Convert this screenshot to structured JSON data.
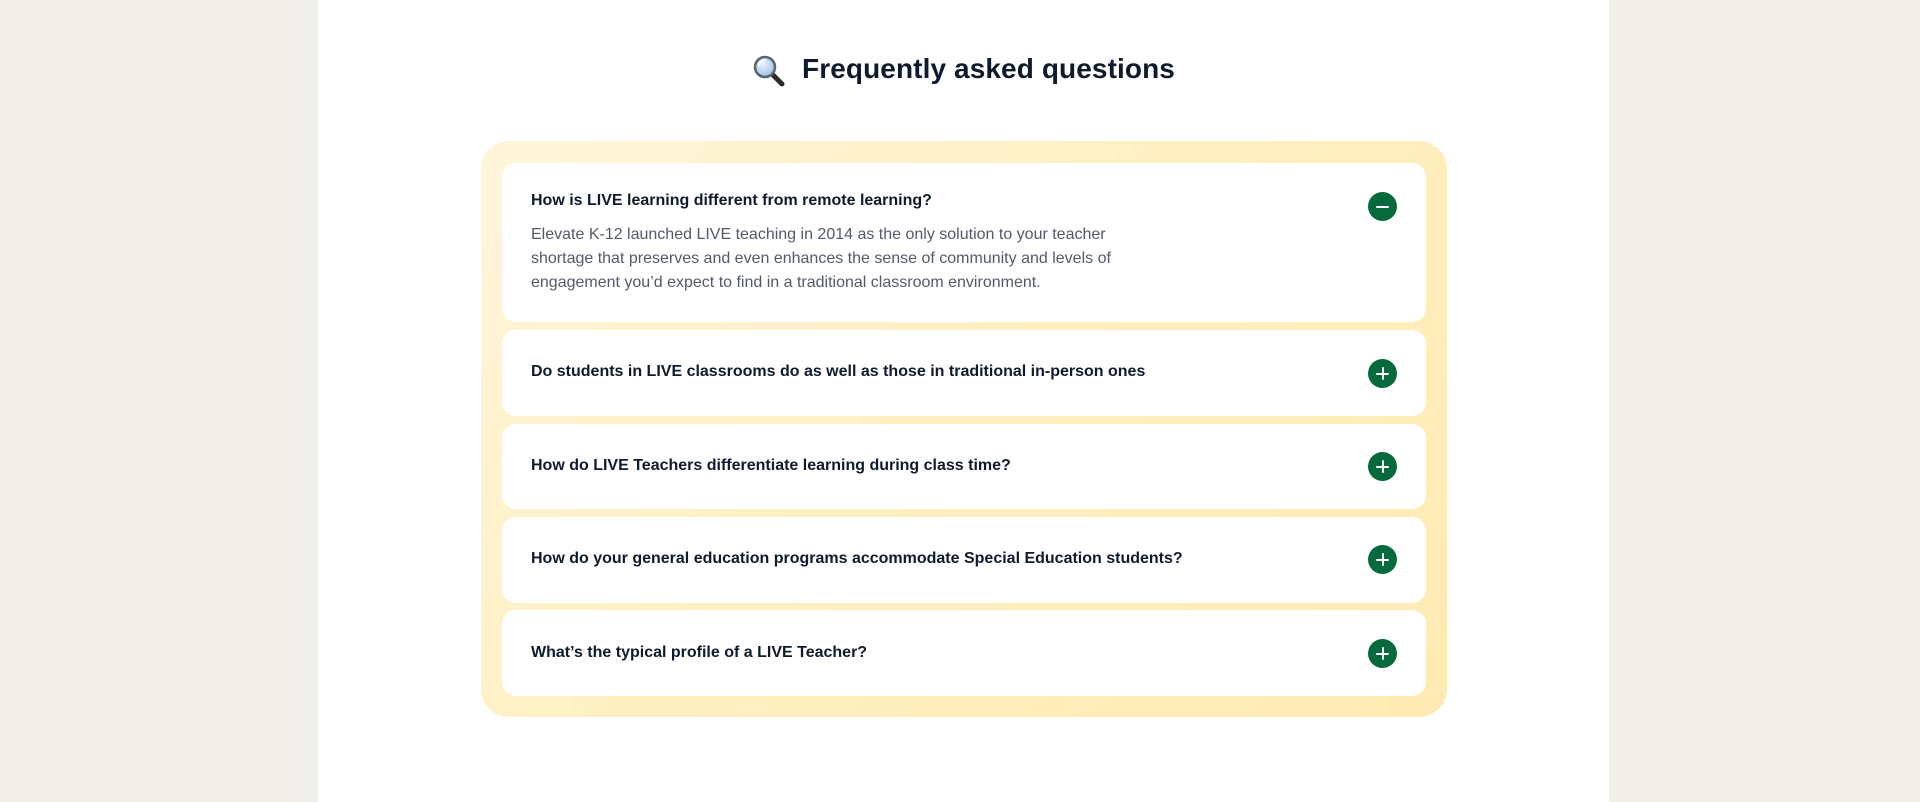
{
  "faq": {
    "title": "Frequently asked questions",
    "title_icon": "magnifying-glass-icon",
    "accent_color": "#066a3c",
    "items": [
      {
        "question": "How is LIVE learning different from remote learning?",
        "answer": "Elevate K-12 launched LIVE teaching in 2014 as the only solution to your teacher shortage that preserves and even enhances the sense of community and levels of engagement you’d expect to find in a traditional classroom environment.",
        "expanded": true,
        "icon": "minus-icon"
      },
      {
        "question": "Do students in LIVE classrooms do as well as those in traditional in-person ones",
        "expanded": false,
        "icon": "plus-icon"
      },
      {
        "question": "How do LIVE Teachers differentiate learning during class time?",
        "expanded": false,
        "icon": "plus-icon"
      },
      {
        "question": "How do your general education programs accommodate Special Education students?",
        "expanded": false,
        "icon": "plus-icon"
      },
      {
        "question": "What’s the typical profile of a LIVE Teacher?",
        "expanded": false,
        "icon": "plus-icon"
      }
    ]
  }
}
